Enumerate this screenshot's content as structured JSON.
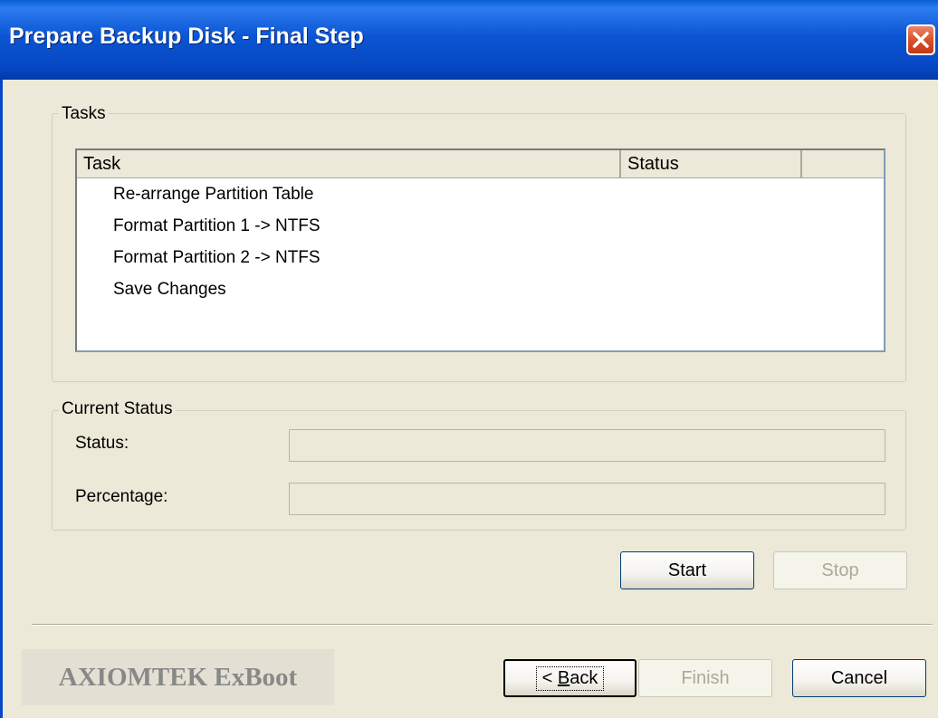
{
  "window": {
    "title": "Prepare Backup Disk - Final Step",
    "close_icon": "close-icon"
  },
  "tasks_group": {
    "label": "Tasks",
    "columns": [
      "Task",
      "Status",
      ""
    ],
    "rows": [
      {
        "task": "Re-arrange Partition Table",
        "status": ""
      },
      {
        "task": "Format Partition 1 -> NTFS",
        "status": ""
      },
      {
        "task": "Format Partition 2 -> NTFS",
        "status": ""
      },
      {
        "task": "Save Changes",
        "status": ""
      }
    ]
  },
  "status_group": {
    "label": "Current Status",
    "status_label": "Status:",
    "status_value": "",
    "percentage_label": "Percentage:",
    "percentage_value": ""
  },
  "buttons": {
    "start": "Start",
    "stop": "Stop",
    "back_prefix": "< ",
    "back_mnemonic": "B",
    "back_rest": "ack",
    "finish": "Finish",
    "cancel": "Cancel"
  },
  "brand": "AXIOMTEK ExBoot",
  "colors": {
    "title_bar": "#0b55d3",
    "dialog_bg": "#ece9d8",
    "close_button": "#d8522b",
    "disabled_text": "#aca899"
  }
}
